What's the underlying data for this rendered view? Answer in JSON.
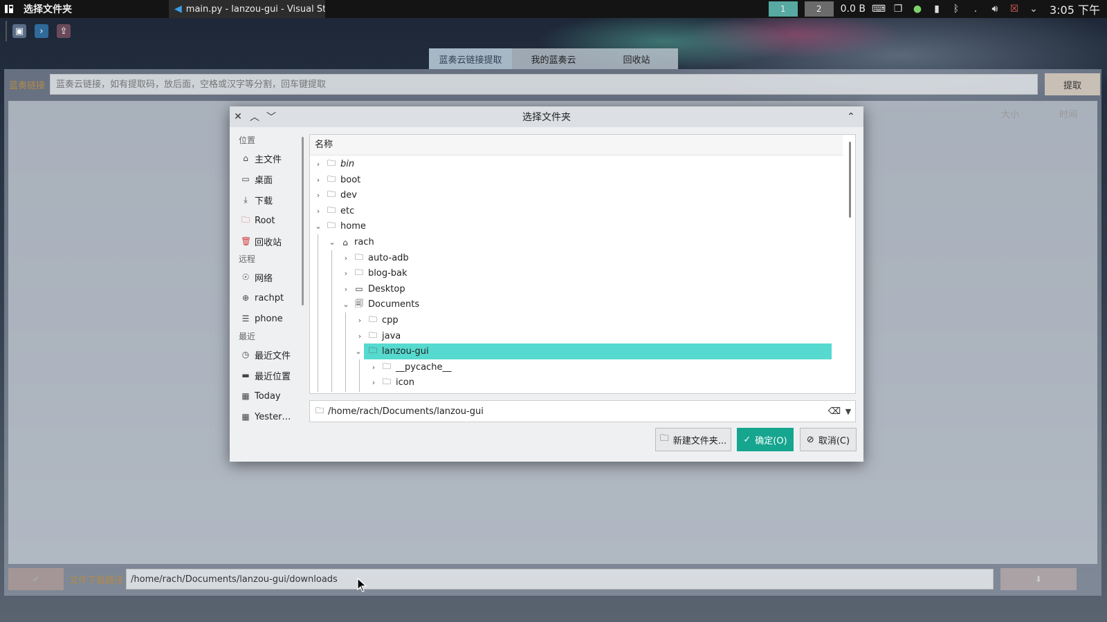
{
  "top_panel": {
    "active_window_title": "选择文件夹",
    "task_vscode_label": "main.py - lanzou-gui - Visual St…",
    "workspaces": [
      "1",
      "2"
    ],
    "net_speed": "0.0 B",
    "clock": "3:05 下午",
    "tray_icons": [
      "keyboard-icon",
      "clipboard-icon",
      "update-check-icon",
      "usb-icon",
      "bluetooth-icon",
      "dot-icon",
      "volume-icon",
      "screen-icon",
      "chevron-down-icon"
    ]
  },
  "app": {
    "tabs": [
      "蓝奏云链接提取",
      "我的蓝奏云",
      "回收站"
    ],
    "active_tab": 0,
    "link_label": "蓝奏链接",
    "link_placeholder": "蓝奏云链接，如有提取码，放后面，空格或汉字等分割，回车键提取",
    "extract_button": "提取",
    "results_columns": [
      "大小",
      "时间"
    ],
    "download_path_label": "文件下载路径",
    "download_path_value": "/home/rach/Documents/lanzou-gui/downloads"
  },
  "dialog": {
    "title": "选择文件夹",
    "places": [
      {
        "type": "section",
        "label": "位置"
      },
      {
        "type": "item",
        "label": "主文件",
        "icon": "home-icon"
      },
      {
        "type": "item",
        "label": "桌面",
        "icon": "desktop-icon"
      },
      {
        "type": "item",
        "label": "下载",
        "icon": "download-icon"
      },
      {
        "type": "item",
        "label": "Root",
        "icon": "root-folder-icon"
      },
      {
        "type": "item",
        "label": "回收站",
        "icon": "trash-icon"
      },
      {
        "type": "section",
        "label": "远程"
      },
      {
        "type": "item",
        "label": "网络",
        "icon": "network-icon"
      },
      {
        "type": "item",
        "label": "rachpt",
        "icon": "remote-icon"
      },
      {
        "type": "item",
        "label": "phone",
        "icon": "phone-icon"
      },
      {
        "type": "section",
        "label": "最近"
      },
      {
        "type": "item",
        "label": "最近文件",
        "icon": "recent-files-icon"
      },
      {
        "type": "item",
        "label": "最近位置",
        "icon": "recent-locations-icon"
      },
      {
        "type": "item",
        "label": "Today",
        "icon": "calendar-icon"
      },
      {
        "type": "item",
        "label": "Yester…",
        "icon": "calendar-icon"
      }
    ],
    "tree_header": "名称",
    "tree": [
      {
        "label": "bin",
        "depth": 0,
        "expanded": false,
        "italic": true,
        "icon": "folder-icon"
      },
      {
        "label": "boot",
        "depth": 0,
        "expanded": false,
        "icon": "folder-icon"
      },
      {
        "label": "dev",
        "depth": 0,
        "expanded": false,
        "icon": "folder-icon"
      },
      {
        "label": "etc",
        "depth": 0,
        "expanded": false,
        "icon": "folder-icon"
      },
      {
        "label": "home",
        "depth": 0,
        "expanded": true,
        "icon": "folder-icon"
      },
      {
        "label": "rach",
        "depth": 1,
        "expanded": true,
        "icon": "home-icon"
      },
      {
        "label": "auto-adb",
        "depth": 2,
        "expanded": false,
        "icon": "folder-icon"
      },
      {
        "label": "blog-bak",
        "depth": 2,
        "expanded": false,
        "icon": "folder-icon"
      },
      {
        "label": "Desktop",
        "depth": 2,
        "expanded": false,
        "icon": "desktop-icon"
      },
      {
        "label": "Documents",
        "depth": 2,
        "expanded": true,
        "icon": "documents-icon"
      },
      {
        "label": "cpp",
        "depth": 3,
        "expanded": false,
        "icon": "folder-icon"
      },
      {
        "label": "java",
        "depth": 3,
        "expanded": false,
        "icon": "folder-icon"
      },
      {
        "label": "lanzou-gui",
        "depth": 3,
        "expanded": true,
        "selected": true,
        "icon": "folder-icon"
      },
      {
        "label": "__pycache__",
        "depth": 4,
        "expanded": false,
        "icon": "folder-icon"
      },
      {
        "label": "icon",
        "depth": 4,
        "expanded": false,
        "icon": "folder-icon"
      }
    ],
    "path_value": "/home/rach/Documents/lanzou-gui",
    "new_folder_button": "新建文件夹...",
    "ok_button": "确定(O)",
    "cancel_button": "取消(C)"
  }
}
